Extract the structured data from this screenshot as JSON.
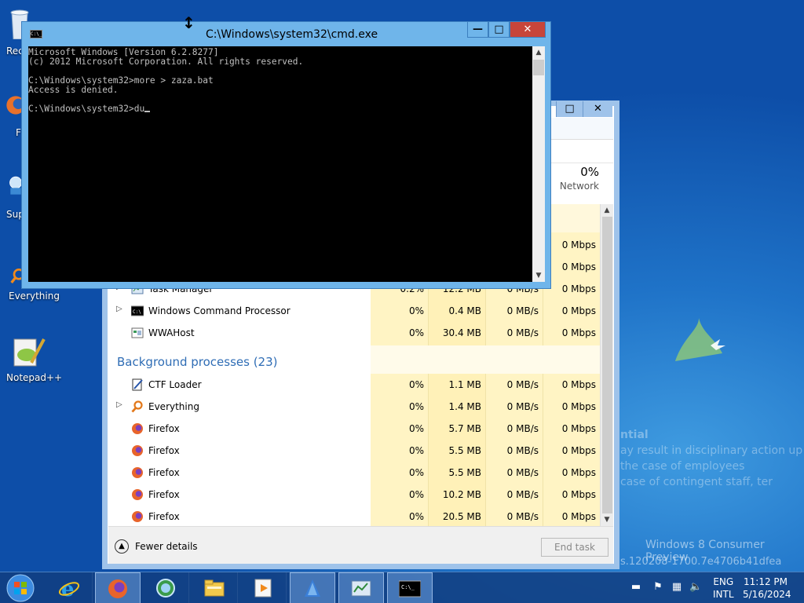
{
  "desktop": {
    "icons": [
      {
        "label": "Rec"
      },
      {
        "label": "F"
      },
      {
        "label": "Sup"
      },
      {
        "label": "Everything"
      },
      {
        "label": "Notepad++"
      }
    ],
    "watermark": {
      "edition": "Windows 8 Consumer Preview",
      "build": "s.120208-1700.7e4706b41dfea"
    },
    "background_text": {
      "line1": "ntial",
      "line2": "ay result in disciplinary action up",
      "line3": "the case of employees",
      "line4": "case of contingent staff, ter"
    }
  },
  "task_manager": {
    "network_header": {
      "percent": "0%",
      "label": "Network"
    },
    "apps_rows": [
      {
        "name": "Task Manager",
        "cpu": "0.2%",
        "memory": "12.2 MB",
        "disk": "0 MB/s",
        "network": "0 Mbps",
        "expandable": true,
        "icon": "task-manager-icon"
      },
      {
        "name": "Windows Command Processor",
        "cpu": "0%",
        "memory": "0.4 MB",
        "disk": "0 MB/s",
        "network": "0 Mbps",
        "expandable": true,
        "icon": "cmd-icon"
      },
      {
        "name": "WWAHost",
        "cpu": "0%",
        "memory": "30.4 MB",
        "disk": "0 MB/s",
        "network": "0 Mbps",
        "expandable": false,
        "icon": "wwahost-icon"
      }
    ],
    "hidden_network_values": [
      "0 Mbps",
      "0 Mbps"
    ],
    "background_header": "Background processes (23)",
    "background_rows": [
      {
        "name": "CTF Loader",
        "cpu": "0%",
        "memory": "1.1 MB",
        "disk": "0 MB/s",
        "network": "0 Mbps",
        "expandable": false,
        "icon": "ctf-loader-icon"
      },
      {
        "name": "Everything",
        "cpu": "0%",
        "memory": "1.4 MB",
        "disk": "0 MB/s",
        "network": "0 Mbps",
        "expandable": true,
        "icon": "everything-search-icon"
      },
      {
        "name": "Firefox",
        "cpu": "0%",
        "memory": "5.7 MB",
        "disk": "0 MB/s",
        "network": "0 Mbps",
        "expandable": false,
        "icon": "firefox-icon"
      },
      {
        "name": "Firefox",
        "cpu": "0%",
        "memory": "5.5 MB",
        "disk": "0 MB/s",
        "network": "0 Mbps",
        "expandable": false,
        "icon": "firefox-icon"
      },
      {
        "name": "Firefox",
        "cpu": "0%",
        "memory": "5.5 MB",
        "disk": "0 MB/s",
        "network": "0 Mbps",
        "expandable": false,
        "icon": "firefox-icon"
      },
      {
        "name": "Firefox",
        "cpu": "0%",
        "memory": "10.2 MB",
        "disk": "0 MB/s",
        "network": "0 Mbps",
        "expandable": false,
        "icon": "firefox-icon"
      },
      {
        "name": "Firefox",
        "cpu": "0%",
        "memory": "20.5 MB",
        "disk": "0 MB/s",
        "network": "0 Mbps",
        "expandable": false,
        "icon": "firefox-icon"
      }
    ],
    "footer": {
      "fewer_details": "Fewer details",
      "end_task": "End task"
    },
    "title_buttons": {
      "maximize": "□",
      "close": "✕"
    }
  },
  "cmd": {
    "title": "C:\\Windows\\system32\\cmd.exe",
    "icon_text": "C:\\_",
    "lines": [
      "Microsoft Windows [Version 6.2.8277]",
      "(c) 2012 Microsoft Corporation. All rights reserved.",
      "",
      "C:\\Windows\\system32>more > zaza.bat",
      "Access is denied.",
      "",
      "C:\\Windows\\system32>du"
    ],
    "buttons": {
      "minimize": "—",
      "maximize": "□",
      "close": "✕"
    }
  },
  "taskbar": {
    "apps": [
      "Internet Explorer",
      "Firefox",
      "Network",
      "File Explorer",
      "Media Player",
      "App",
      "Task Manager",
      "Command Prompt"
    ],
    "tray": {
      "lang": "ENG",
      "layout": "INTL",
      "time": "11:12 PM",
      "date": "5/16/2024"
    }
  },
  "colors": {
    "accent": "#2f6db5",
    "cmd_frame": "#6fb5ea",
    "close_red": "#c7453a",
    "shade": "#fff4c4"
  }
}
